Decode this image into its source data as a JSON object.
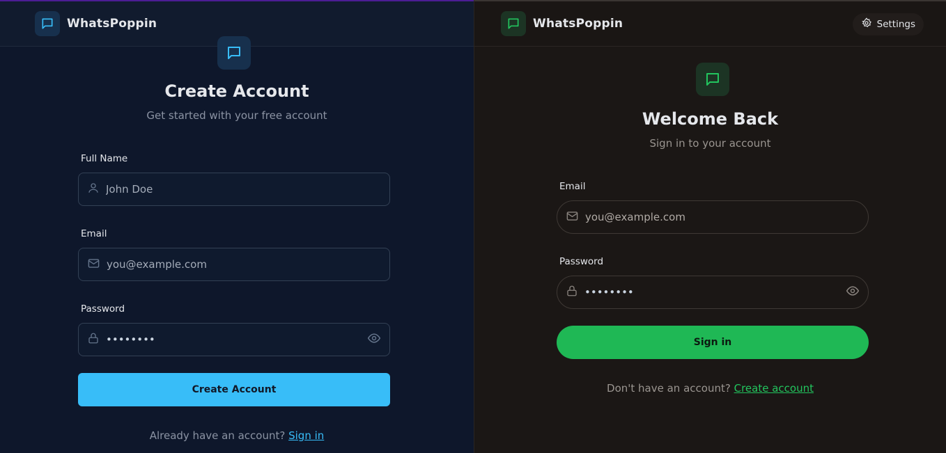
{
  "left": {
    "brand": "WhatsPoppin",
    "title": "Create Account",
    "subtitle": "Get started with your free account",
    "fields": {
      "name": {
        "label": "Full Name",
        "placeholder": "John Doe"
      },
      "email": {
        "label": "Email",
        "placeholder": "you@example.com"
      },
      "password": {
        "label": "Password",
        "value": "••••••••"
      }
    },
    "button": "Create Account",
    "footer_text": "Already have an account?",
    "footer_link": "Sign in",
    "accent": "#38bdf8"
  },
  "right": {
    "brand": "WhatsPoppin",
    "settings": "Settings",
    "title": "Welcome Back",
    "subtitle": "Sign in to your account",
    "fields": {
      "email": {
        "label": "Email",
        "placeholder": "you@example.com"
      },
      "password": {
        "label": "Password",
        "value": "••••••••"
      }
    },
    "button": "Sign in",
    "footer_text": "Don't have an account?",
    "footer_link": "Create account",
    "accent": "#22c55e"
  },
  "icons": {
    "chat": "chat-bubble-icon",
    "user": "user-icon",
    "mail": "mail-icon",
    "lock": "lock-icon",
    "eye": "eye-icon",
    "gear": "gear-icon"
  }
}
